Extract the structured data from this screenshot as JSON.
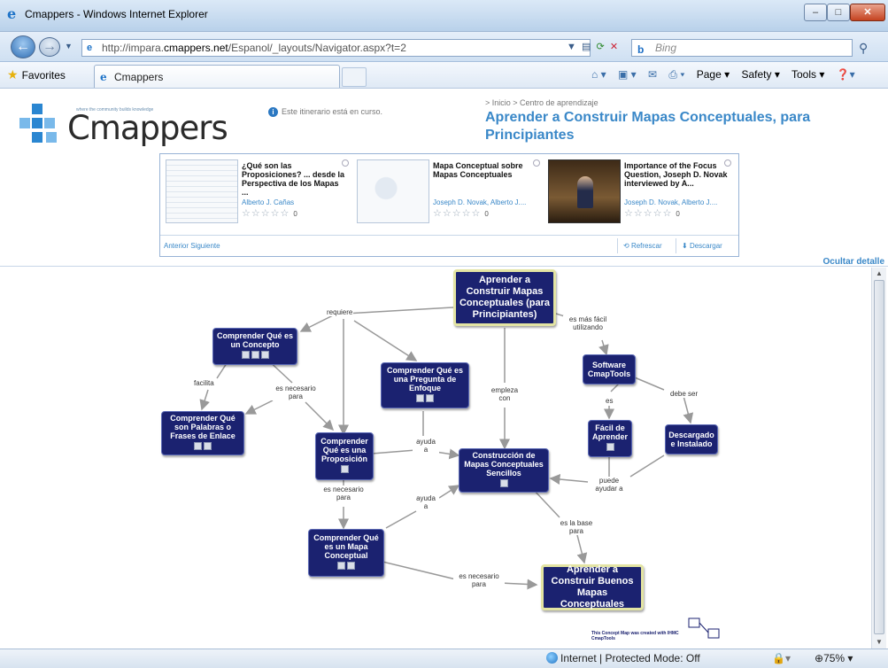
{
  "window": {
    "title": "Cmappers - Windows Internet Explorer"
  },
  "address": {
    "url_prefix": "http://impara.",
    "url_domain": "cmappers.net",
    "url_path": "/Espanol/_layouts/Navigator.aspx?t=2",
    "search_placeholder": "Bing"
  },
  "favbar": {
    "favorites": "Favorites",
    "tab_title": "Cmappers",
    "page": "Page ▾",
    "safety": "Safety ▾",
    "tools": "Tools ▾"
  },
  "page": {
    "logo_text": "Cmappers",
    "logo_tagline": "where the community builds knowledge",
    "info_note": "Este itinerario está en curso.",
    "breadcrumb": "> Inicio > Centro de aprendizaje",
    "title": "Aprender a Construir Mapas Conceptuales, para Principiantes",
    "cards": [
      {
        "title": "¿Qué son las Proposiciones? ... desde la Perspectiva de los Mapas ...",
        "author": "Alberto J. Cañas",
        "rating": "0"
      },
      {
        "title": "Mapa Conceptual sobre Mapas Conceptuales",
        "author": "Joseph D. Novak, Alberto J....",
        "rating": "0"
      },
      {
        "title": "Importance of the Focus Question, Joseph D. Novak interviewed by A...",
        "author": "Joseph D. Novak, Alberto J....",
        "rating": "0"
      }
    ],
    "nav_prev_next": "Anterior Siguiente",
    "refresh": "Refrescar",
    "download": "Descargar",
    "hide_details": "Ocultar detalle"
  },
  "cmap": {
    "nodes": {
      "main": "Aprender a Construir Mapas Conceptuales (para Principiantes)",
      "concepto": "Comprender Qué es un Concepto",
      "pregunta": "Comprender Qué es una Pregunta de Enfoque",
      "software": "Software CmapTools",
      "palabras": "Comprender Qué son Palabras o Frases de Enlace",
      "proposicion": "Comprender Qué es una Proposición",
      "construccion": "Construcción de Mapas Conceptuales Sencillos",
      "facil": "Fácil de Aprender",
      "descargado": "Descargado e Instalado",
      "mapa": "Comprender Qué es un Mapa Conceptual",
      "buenos": "Aprender a Construir Buenos Mapas Conceptuales"
    },
    "links": {
      "requiere": "requiere",
      "es_mas_facil": "es más fácil utilizando",
      "facilita": "facilita",
      "es_necesario_1": "es necesario para",
      "empleza_con": "empleza con",
      "debe_ser": "debe ser",
      "es": "es",
      "ayuda_1": "ayuda a",
      "puede_ayudar": "puede ayudar a",
      "es_necesario_2": "es necesario para",
      "ayuda_2": "ayuda a",
      "es_la_base": "es la base para",
      "es_necesario_3": "es necesario para"
    },
    "credit": "This Concept Map was created with IHMC CmapTools"
  },
  "status": {
    "zone": "Internet | Protected Mode: Off",
    "zoom": "75%"
  }
}
